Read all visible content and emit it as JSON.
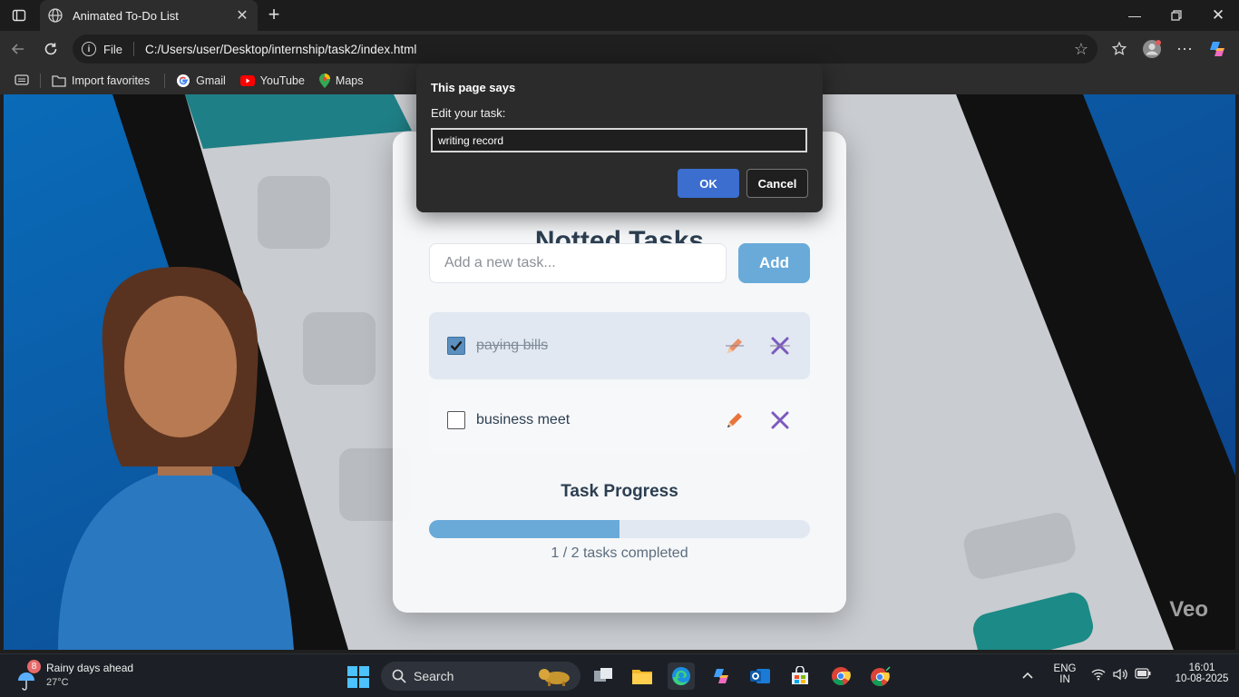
{
  "browser": {
    "tab_title": "Animated To-Do List",
    "address_scheme": "File",
    "address_url": "C:/Users/user/Desktop/internship/task2/index.html",
    "favorites": [
      {
        "label": "Import favorites"
      },
      {
        "label": "Gmail"
      },
      {
        "label": "YouTube"
      },
      {
        "label": "Maps"
      }
    ]
  },
  "app": {
    "title": "Notted Tasks",
    "input_placeholder": "Add a new task...",
    "add_label": "Add",
    "tasks": [
      {
        "text": "paying bills",
        "completed": true
      },
      {
        "text": "business meet",
        "completed": false
      }
    ],
    "progress_title": "Task Progress",
    "progress_fraction": 0.5,
    "progress_text": "1 / 2 tasks completed",
    "watermark": "Veo"
  },
  "dialog": {
    "title": "This page says",
    "message": "Edit your task:",
    "input_value": "writing record",
    "ok_label": "OK",
    "cancel_label": "Cancel"
  },
  "taskbar": {
    "weather_title": "Rainy days ahead",
    "weather_temp": "27°C",
    "weather_badge": "8",
    "search_label": "Search",
    "lang_line1": "ENG",
    "lang_line2": "IN",
    "time": "16:01",
    "date": "10-08-2025"
  },
  "colors": {
    "accent": "#6aaad8",
    "dialog_ok": "#3b6ecf",
    "edit_icon": "#e8743b",
    "delete_icon": "#7d5bbe"
  }
}
